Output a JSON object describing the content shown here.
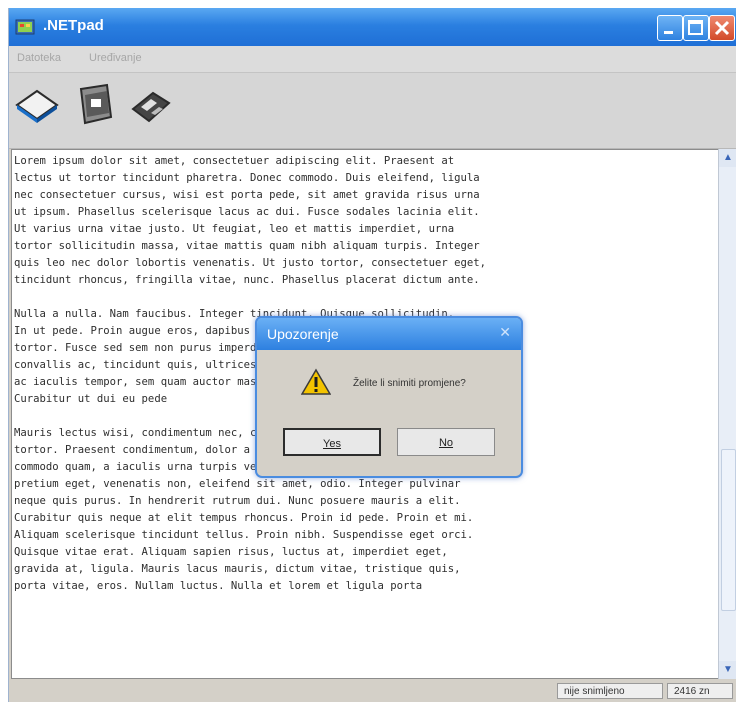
{
  "window": {
    "title": ".NETpad"
  },
  "menu": {
    "items": [
      "Datoteka",
      "Uređivanje"
    ]
  },
  "toolbar": {
    "icons": [
      "new-file-icon",
      "open-file-icon",
      "save-file-icon"
    ]
  },
  "editor": {
    "text": "Lorem ipsum dolor sit amet, consectetuer adipiscing elit. Praesent at\nlectus ut tortor tincidunt pharetra. Donec commodo. Duis eleifend, ligula\nnec consectetuer cursus, wisi est porta pede, sit amet gravida risus urna\nut ipsum. Phasellus scelerisque lacus ac dui. Fusce sodales lacinia elit.\nUt varius urna vitae justo. Ut feugiat, leo et mattis imperdiet, urna\ntortor sollicitudin massa, vitae mattis quam nibh aliquam turpis. Integer\nquis leo nec dolor lobortis venenatis. Ut justo tortor, consectetuer eget,\ntincidunt rhoncus, fringilla vitae, nunc. Phasellus placerat dictum ante.\n\nNulla a nulla. Nam faucibus. Integer tincidunt. Quisque sollicitudin.\nIn ut pede. Proin augue eros, dapibus et, semper id, tincidunt in,\ntortor. Fusce sed sem non purus imperdiet volutpat. Donec urna sapien,\nconvallis ac, tincidunt quis, ultrices eget, erat. Quisque eleifend, erat\nac iaculis tempor, sem quam auctor massa, interdum massa leo a elit.\nCurabitur ut dui eu pede\n\nMauris lectus wisi, condimentum nec, condimentum vestibulum, pretium non,\ntortor. Praesent condimentum, dolor a adipiscing facilisis, velit tellus\ncommodo quam, a iaculis urna turpis vel massa. Vestibulum odio justo,\npretium eget, venenatis non, eleifend sit amet, odio. Integer pulvinar\nneque quis purus. In hendrerit rutrum dui. Nunc posuere mauris a elit.\nCurabitur quis neque at elit tempus rhoncus. Proin id pede. Proin et mi.\nAliquam scelerisque tincidunt tellus. Proin nibh. Suspendisse eget orci.\nQuisque vitae erat. Aliquam sapien risus, luctus at, imperdiet eget,\ngravida at, ligula. Mauris lacus mauris, dictum vitae, tristique quis,\nporta vitae, eros. Nullam luctus. Nulla et lorem et ligula porta"
  },
  "status": {
    "state": "nije snimljeno",
    "count": "2416 zn"
  },
  "dialog": {
    "title": "Upozorenje",
    "message": "Želite li snimiti promjene?",
    "yes_label": "Yes",
    "no_label": "No",
    "icon": "warning-icon"
  },
  "colors": {
    "titlebar": "#2a7fe0",
    "dialog_border": "#4a8ce0"
  }
}
